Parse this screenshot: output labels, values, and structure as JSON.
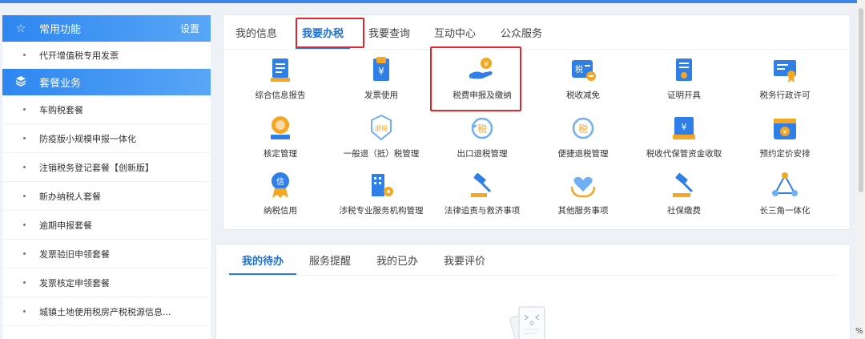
{
  "sidebar": {
    "sections": [
      {
        "title": "常用功能",
        "action": "设置",
        "icon": "star-icon"
      },
      {
        "title": "套餐业务",
        "icon": "layers-icon"
      }
    ],
    "common_items": [
      "代开增值税专用发票"
    ],
    "package_items": [
      "车购税套餐",
      "防疫版小规模申报一体化",
      "注销税务登记套餐【创新版】",
      "新办纳税人套餐",
      "逾期申报套餐",
      "发票验旧申领套餐",
      "发票核定申领套餐",
      "城镇土地使用税房产税税源信息..."
    ]
  },
  "top_tabs": [
    "我的信息",
    "我要办税",
    "我要查询",
    "互动中心",
    "公众服务"
  ],
  "active_top_tab": "我要办税",
  "services": [
    {
      "label": "综合信息报告",
      "icon": "report-doc-icon"
    },
    {
      "label": "发票使用",
      "icon": "invoice-yen-icon"
    },
    {
      "label": "税费申报及缴纳",
      "icon": "hand-coin-icon"
    },
    {
      "label": "税收减免",
      "icon": "tax-reduction-icon"
    },
    {
      "label": "证明开具",
      "icon": "certificate-icon"
    },
    {
      "label": "税务行政许可",
      "icon": "license-ribbon-icon"
    },
    {
      "label": "核定管理",
      "icon": "approval-stamp-icon"
    },
    {
      "label": "一般退（抵）税管理",
      "icon": "refund-badge-icon"
    },
    {
      "label": "出口退税管理",
      "icon": "export-refund-icon"
    },
    {
      "label": "便捷退税管理",
      "icon": "quick-refund-icon"
    },
    {
      "label": "税收代保管资金收取",
      "icon": "custody-fund-icon"
    },
    {
      "label": "预约定价安排",
      "icon": "calendar-yen-icon"
    },
    {
      "label": "纳税信用",
      "icon": "credit-medal-icon"
    },
    {
      "label": "涉税专业服务机构管理",
      "icon": "building-gear-icon"
    },
    {
      "label": "法律追责与救济事项",
      "icon": "gavel-icon"
    },
    {
      "label": "其他服务事项",
      "icon": "heart-hands-icon"
    },
    {
      "label": "社保缴费",
      "icon": "gavel-social-icon"
    },
    {
      "label": "长三角一体化",
      "icon": "triangle-network-icon"
    }
  ],
  "bottom_tabs": [
    "我的待办",
    "服务提醒",
    "我的已办",
    "我要评价"
  ],
  "active_bottom_tab": "我的待办",
  "empty_state_icon": "empty-document-icon",
  "colors": {
    "accent": "#2a7be4",
    "highlight": "#e0262d",
    "icon_orange": "#f5a623"
  },
  "corner_text": "%"
}
